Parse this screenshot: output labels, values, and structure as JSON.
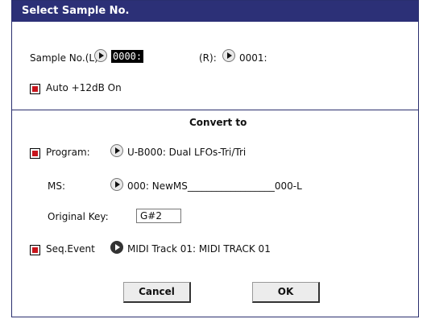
{
  "dialog": {
    "title": "Select Sample No.",
    "sample": {
      "left_label": "Sample No.(L):",
      "left_value": "0000:",
      "right_label": "(R):",
      "right_value": "0001:"
    },
    "auto12db": {
      "label": "Auto +12dB On",
      "checked": true
    },
    "convert_to": {
      "heading": "Convert to",
      "program": {
        "label": "Program:",
        "value": "U-B000: Dual LFOs-Tri/Tri",
        "checked": true
      },
      "ms": {
        "label": "MS:",
        "value": "000: NewMS__________________000-L"
      },
      "original_key": {
        "label": "Original Key:",
        "value": "G#2"
      },
      "seq_event": {
        "label": "Seq.Event",
        "value": "MIDI Track 01: MIDI TRACK 01",
        "checked": true
      }
    },
    "buttons": {
      "cancel": "Cancel",
      "ok": "OK"
    }
  }
}
